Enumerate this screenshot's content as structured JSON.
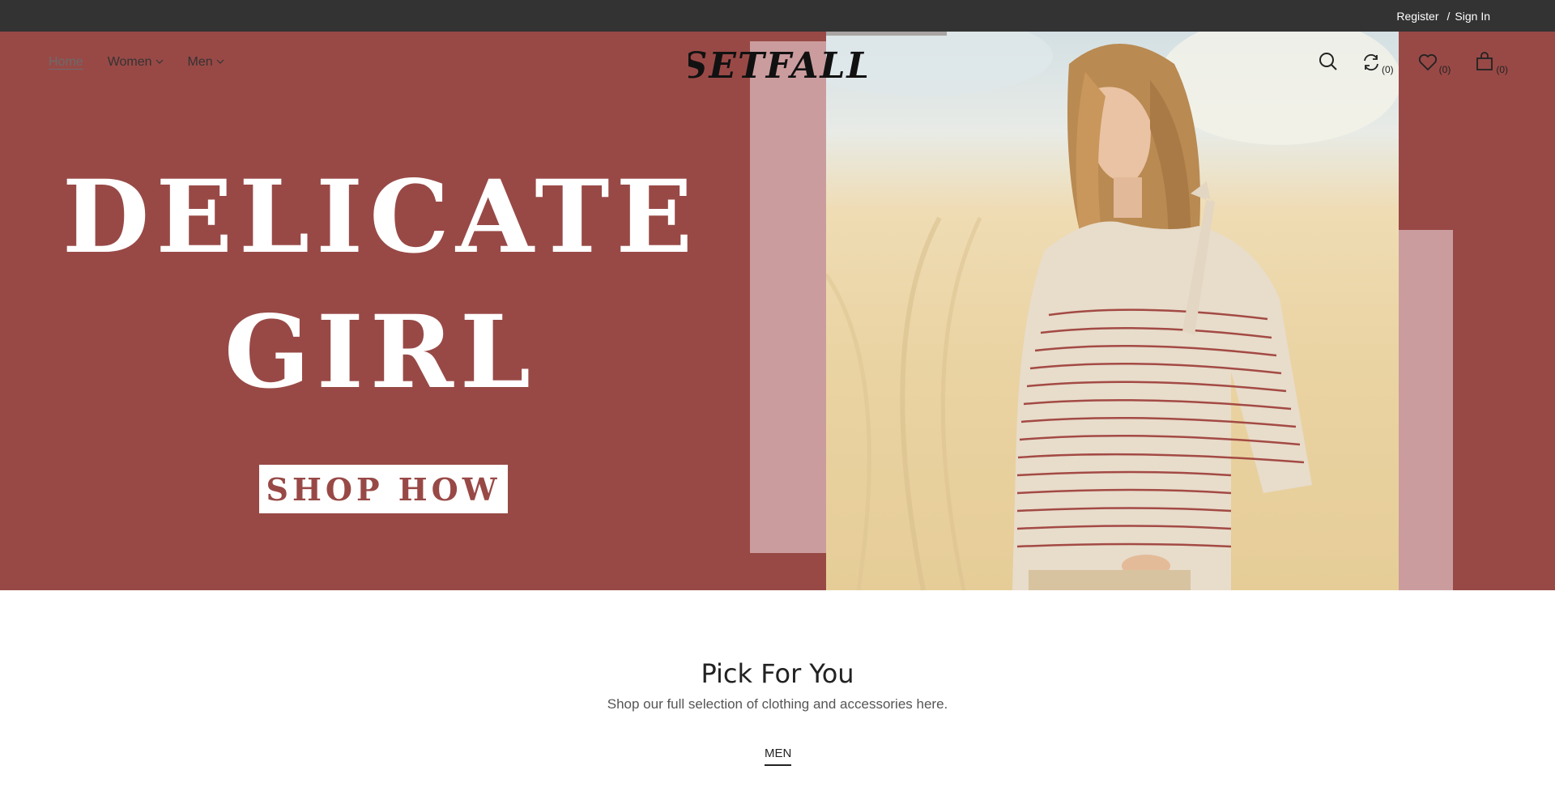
{
  "topbar": {
    "register_label": "Register",
    "separator": "/",
    "signin_label": "Sign In"
  },
  "nav": {
    "home_label": "Home",
    "women_label": "Women",
    "men_label": "Men"
  },
  "logo": {
    "text": "SETFALL"
  },
  "header_icons": {
    "compare_count": "(0)",
    "wishlist_count": "(0)",
    "cart_count": "(0)",
    "icons": [
      "search-icon",
      "compare-icon",
      "heart-icon",
      "bag-icon"
    ]
  },
  "hero": {
    "headline_line1": "DELICATE",
    "headline_line2": "GIRL",
    "cta_label": "SHOP HOW",
    "background_color": "#984946",
    "accent_color": "#cb9c9e"
  },
  "pick_section": {
    "title": "Pick For You",
    "subtitle": "Shop our full selection of clothing and accessories here.",
    "tab_label": "MEN"
  }
}
